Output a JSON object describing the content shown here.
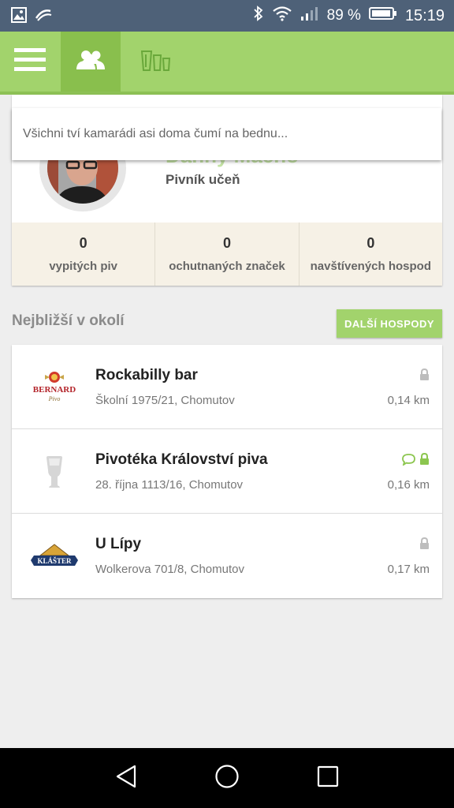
{
  "status_bar": {
    "battery_percent": "89 %",
    "time": "15:19",
    "icons": [
      "gallery-icon",
      "sync-icon",
      "bluetooth-icon",
      "wifi-icon",
      "signal-icon",
      "battery-icon"
    ]
  },
  "app_bar": {
    "icons": [
      "menu-icon",
      "friends-icon",
      "beers-icon"
    ],
    "active_tab": "friends",
    "accent": "#a2d36c"
  },
  "profile": {
    "name": "Danny Macho",
    "rank": "Pivník učeň",
    "stats": [
      {
        "value": "0",
        "label": "vypitých piv"
      },
      {
        "value": "0",
        "label": "ochutnaných značek"
      },
      {
        "value": "0",
        "label": "navštívených hospod"
      }
    ]
  },
  "notice": {
    "text": "Všichni tví kamarádi asi doma čumí na bednu..."
  },
  "nearby": {
    "title": "Nejbližší v okolí",
    "more_button": "DALŠÍ HOSPODY",
    "pubs": [
      {
        "name": "Rockabilly bar",
        "address": "Školní 1975/21, Chomutov",
        "distance": "0,14 km",
        "logo_text": "BERNARD",
        "logo_sub": "Pivo",
        "comment": false,
        "locked_highlight": false
      },
      {
        "name": "Pivotéka Království piva",
        "address": "28. října 1113/16, Chomutov",
        "distance": "0,16 km",
        "logo_text": "",
        "logo_sub": "",
        "comment": true,
        "locked_highlight": true
      },
      {
        "name": "U Lípy",
        "address": "Wolkerova 701/8, Chomutov",
        "distance": "0,17 km",
        "logo_text": "KLÁŠTER",
        "logo_sub": "",
        "comment": false,
        "locked_highlight": false
      }
    ]
  },
  "nav_bar": {
    "icons": [
      "back-icon",
      "home-icon",
      "recents-icon"
    ]
  }
}
